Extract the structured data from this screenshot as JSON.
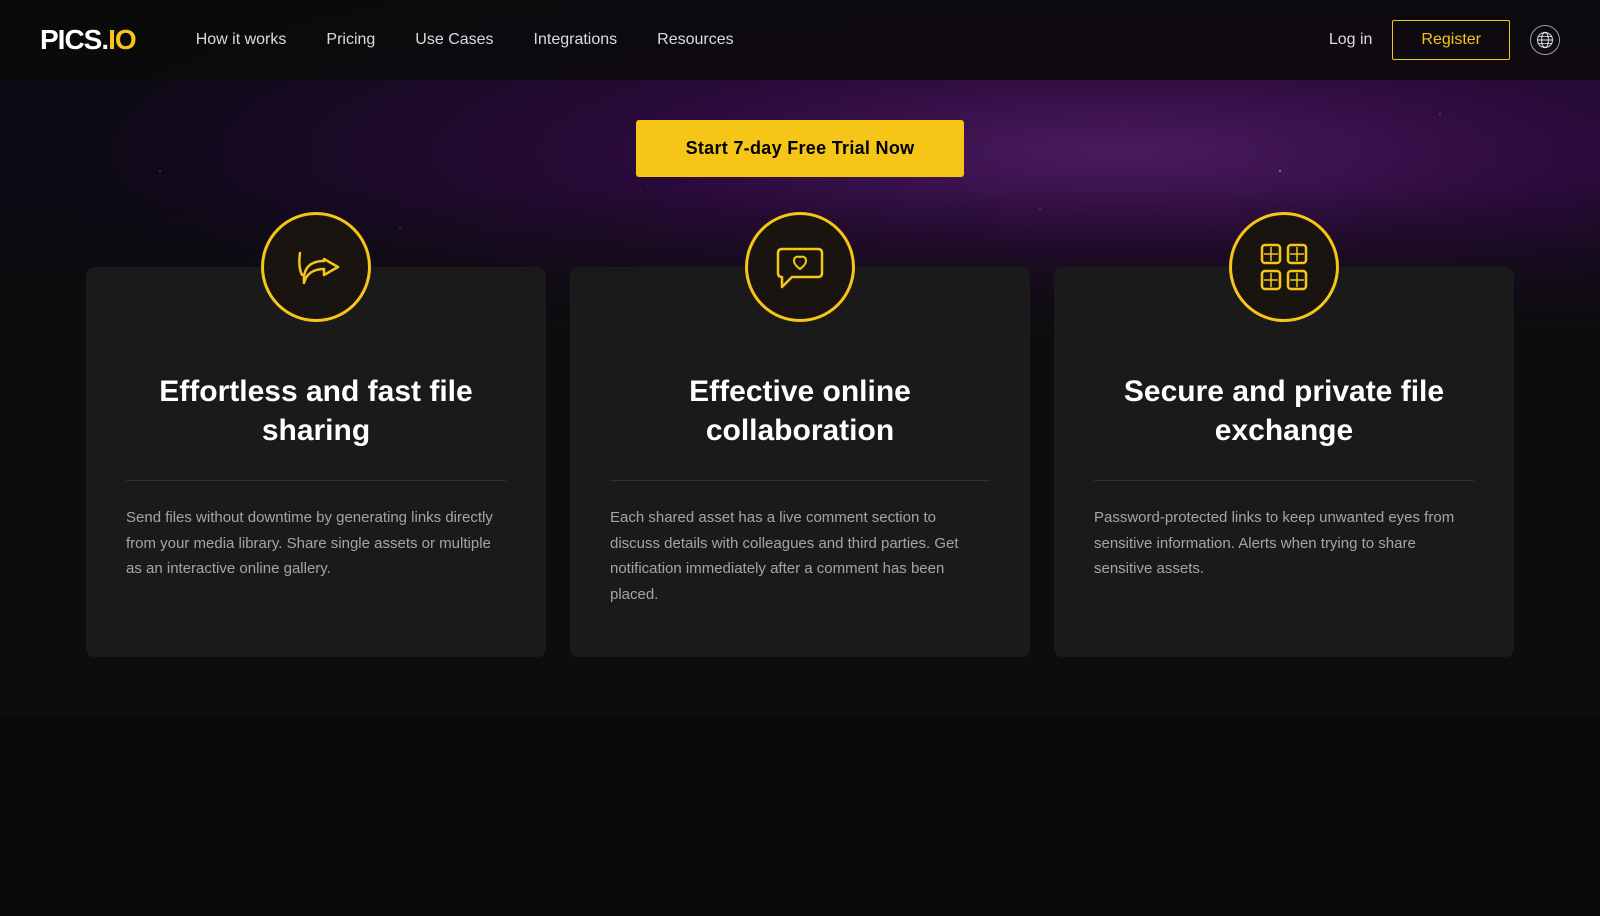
{
  "logo": {
    "text": "PICS.IO",
    "styled": "pics.io"
  },
  "nav": {
    "links": [
      {
        "label": "How it works",
        "id": "how-it-works"
      },
      {
        "label": "Pricing",
        "id": "pricing"
      },
      {
        "label": "Use Cases",
        "id": "use-cases"
      },
      {
        "label": "Integrations",
        "id": "integrations"
      },
      {
        "label": "Resources",
        "id": "resources"
      }
    ],
    "login_label": "Log in",
    "register_label": "Register",
    "globe_label": "🌐"
  },
  "cta": {
    "button_label": "Start 7-day Free Trial Now"
  },
  "cards": [
    {
      "id": "sharing",
      "title": "Effortless and fast file sharing",
      "description": "Send files without downtime by generating links directly from your media library. Share single assets or multiple as an interactive online gallery.",
      "icon": "share-icon"
    },
    {
      "id": "collaboration",
      "title": "Effective online collaboration",
      "description": "Each shared asset has a live comment section to discuss details with colleagues and third parties. Get notification immediately after a comment has been placed.",
      "icon": "chat-heart-icon"
    },
    {
      "id": "security",
      "title": "Secure and private file exchange",
      "description": "Password-protected links to keep unwanted eyes from sensitive information. Alerts when trying to share sensitive assets.",
      "icon": "grid-lock-icon"
    }
  ],
  "colors": {
    "accent": "#f5c518",
    "card_bg": "#1a1a1a",
    "text_secondary": "rgba(255,255,255,0.6)"
  }
}
